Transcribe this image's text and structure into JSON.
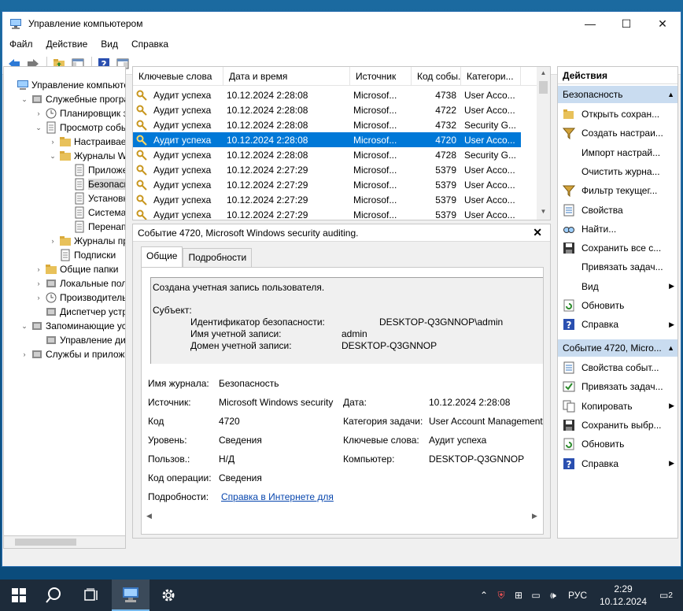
{
  "window": {
    "title": "Управление компьютером",
    "minimize": "—",
    "maximize": "☐",
    "close": "✕"
  },
  "menu": [
    "Файл",
    "Действие",
    "Вид",
    "Справка"
  ],
  "tree": [
    {
      "label": "Управление компьютер",
      "exp": "",
      "indent": 0
    },
    {
      "label": "Служебные програм",
      "exp": "⌄",
      "indent": 1
    },
    {
      "label": "Планировщик за",
      "exp": "›",
      "indent": 2
    },
    {
      "label": "Просмотр событ",
      "exp": "⌄",
      "indent": 2
    },
    {
      "label": "Настраиваем",
      "exp": "›",
      "indent": 3
    },
    {
      "label": "Журналы Wir",
      "exp": "⌄",
      "indent": 3
    },
    {
      "label": "Приложен",
      "exp": "",
      "indent": 4
    },
    {
      "label": "Безопаснс",
      "exp": "",
      "indent": 4,
      "selected": true
    },
    {
      "label": "Установка",
      "exp": "",
      "indent": 4
    },
    {
      "label": "Система",
      "exp": "",
      "indent": 4
    },
    {
      "label": "Перенапр",
      "exp": "",
      "indent": 4
    },
    {
      "label": "Журналы при",
      "exp": "›",
      "indent": 3
    },
    {
      "label": "Подписки",
      "exp": "",
      "indent": 3
    },
    {
      "label": "Общие папки",
      "exp": "›",
      "indent": 2
    },
    {
      "label": "Локальные польз",
      "exp": "›",
      "indent": 2
    },
    {
      "label": "Производительн",
      "exp": "›",
      "indent": 2
    },
    {
      "label": "Диспетчер устро",
      "exp": "",
      "indent": 2
    },
    {
      "label": "Запоминающие устр",
      "exp": "⌄",
      "indent": 1
    },
    {
      "label": "Управление диск",
      "exp": "",
      "indent": 2
    },
    {
      "label": "Службы и приложен",
      "exp": "›",
      "indent": 1
    }
  ],
  "list": {
    "headers": [
      "Ключевые слова",
      "Дата и время",
      "Источник",
      "Код собы...",
      "Категори..."
    ],
    "rows": [
      {
        "kw": "Аудит успеха",
        "dt": "10.12.2024 2:28:08",
        "src": "Microsof...",
        "code": "4738",
        "cat": "User Acco..."
      },
      {
        "kw": "Аудит успеха",
        "dt": "10.12.2024 2:28:08",
        "src": "Microsof...",
        "code": "4722",
        "cat": "User Acco..."
      },
      {
        "kw": "Аудит успеха",
        "dt": "10.12.2024 2:28:08",
        "src": "Microsof...",
        "code": "4732",
        "cat": "Security G..."
      },
      {
        "kw": "Аудит успеха",
        "dt": "10.12.2024 2:28:08",
        "src": "Microsof...",
        "code": "4720",
        "cat": "User Acco...",
        "selected": true
      },
      {
        "kw": "Аудит успеха",
        "dt": "10.12.2024 2:28:08",
        "src": "Microsof...",
        "code": "4728",
        "cat": "Security G..."
      },
      {
        "kw": "Аудит успеха",
        "dt": "10.12.2024 2:27:29",
        "src": "Microsof...",
        "code": "5379",
        "cat": "User Acco..."
      },
      {
        "kw": "Аудит успеха",
        "dt": "10.12.2024 2:27:29",
        "src": "Microsof...",
        "code": "5379",
        "cat": "User Acco..."
      },
      {
        "kw": "Аудит успеха",
        "dt": "10.12.2024 2:27:29",
        "src": "Microsof...",
        "code": "5379",
        "cat": "User Acco..."
      },
      {
        "kw": "Аудит успеха",
        "dt": "10.12.2024 2:27:29",
        "src": "Microsof...",
        "code": "5379",
        "cat": "User Acco..."
      }
    ]
  },
  "detail": {
    "header": "Событие 4720, Microsoft Windows security auditing.",
    "tab_general": "Общие",
    "tab_details": "Подробности",
    "msg_line1": "Создана учетная запись пользователя.",
    "msg_subject": "Субъект:",
    "msg_sid_label": "Идентификатор безопасности:",
    "msg_sid_value": "DESKTOP-Q3GNNOP\\admin",
    "msg_acct_label": "Имя учетной записи:",
    "msg_acct_value": "admin",
    "msg_domain_label": "Домен учетной записи:",
    "msg_domain_value": "DESKTOP-Q3GNNOP",
    "log_label": "Имя журнала:",
    "log_value": "Безопасность",
    "source_label": "Источник:",
    "source_value": "Microsoft Windows security",
    "date_label": "Дата:",
    "date_value": "10.12.2024 2:28:08",
    "code_label": "Код",
    "code_value": "4720",
    "taskcat_label": "Категория задачи:",
    "taskcat_value": "User Account Management",
    "level_label": "Уровень:",
    "level_value": "Сведения",
    "keywords_label": "Ключевые слова:",
    "keywords_value": "Аудит успеха",
    "user_label": "Пользов.:",
    "user_value": "Н/Д",
    "computer_label": "Компьютер:",
    "computer_value": "DESKTOP-Q3GNNOP",
    "opcode_label": "Код операции:",
    "opcode_value": "Сведения",
    "more_label": "Подробности:",
    "more_link": "Справка в Интернете для "
  },
  "actions": {
    "title": "Действия",
    "section1": "Безопасность",
    "items1": [
      {
        "label": "Открыть сохран...",
        "icon": "folder-open-icon",
        "arrow": ""
      },
      {
        "label": "Создать настраи...",
        "icon": "filter-icon",
        "arrow": ""
      },
      {
        "label": "Импорт настрай...",
        "icon": "none",
        "arrow": ""
      },
      {
        "label": "Очистить журна...",
        "icon": "none",
        "arrow": ""
      },
      {
        "label": "Фильтр текущег...",
        "icon": "filter-icon",
        "arrow": ""
      },
      {
        "label": "Свойства",
        "icon": "properties-icon",
        "arrow": ""
      },
      {
        "label": "Найти...",
        "icon": "find-icon",
        "arrow": ""
      },
      {
        "label": "Сохранить все с...",
        "icon": "save-icon",
        "arrow": ""
      },
      {
        "label": "Привязать задач...",
        "icon": "none",
        "arrow": ""
      },
      {
        "label": "Вид",
        "icon": "none",
        "arrow": "▶"
      },
      {
        "label": "Обновить",
        "icon": "refresh-icon",
        "arrow": ""
      },
      {
        "label": "Справка",
        "icon": "help-icon",
        "arrow": "▶"
      }
    ],
    "section2": "Событие 4720, Micro...",
    "items2": [
      {
        "label": "Свойства событ...",
        "icon": "properties-icon",
        "arrow": ""
      },
      {
        "label": "Привязать задач...",
        "icon": "task-icon",
        "arrow": ""
      },
      {
        "label": "Копировать",
        "icon": "copy-icon",
        "arrow": "▶"
      },
      {
        "label": "Сохранить выбр...",
        "icon": "save-icon",
        "arrow": ""
      },
      {
        "label": "Обновить",
        "icon": "refresh-icon",
        "arrow": ""
      },
      {
        "label": "Справка",
        "icon": "help-icon",
        "arrow": "▶"
      }
    ]
  },
  "taskbar": {
    "lang": "РУС",
    "time": "2:29",
    "date": "10.12.2024",
    "notifications": "2"
  }
}
